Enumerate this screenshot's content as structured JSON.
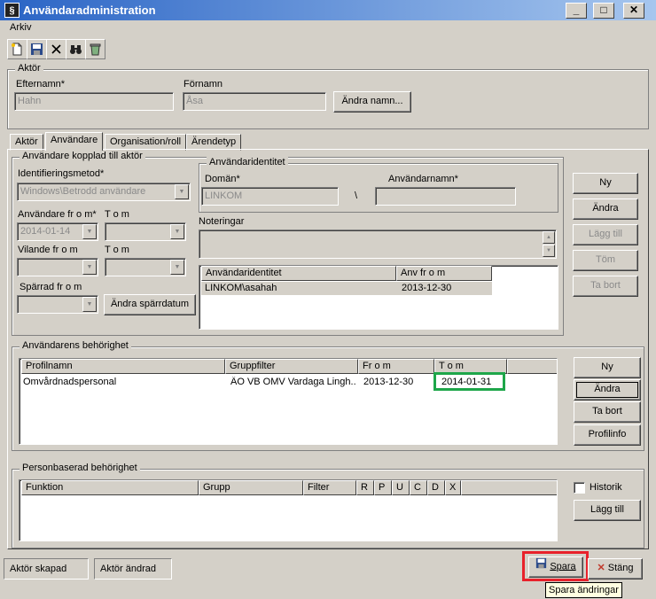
{
  "window": {
    "title": "Användaradministration",
    "minimize": "_",
    "maximize": "□",
    "close": "✕"
  },
  "menu": {
    "arkiv": "Arkiv"
  },
  "toolbar": {
    "icons": [
      "new-document-icon",
      "save-icon",
      "delete-icon",
      "binoculars-icon",
      "recycle-bin-icon"
    ]
  },
  "aktor": {
    "legend": "Aktör",
    "efternamn_label": "Efternamn*",
    "efternamn_value": "Hahn",
    "fornamn_label": "Förnamn",
    "fornamn_value": "Åsa",
    "andra_namn_button": "Ändra namn..."
  },
  "tabs": [
    "Aktör",
    "Användare",
    "Organisation/roll",
    "Ärendetyp"
  ],
  "active_tab": "Användare",
  "anvandare_kopplad": {
    "legend": "Användare kopplad till aktör",
    "identifieringsmetod_label": "Identifieringsmetod*",
    "identifieringsmetod_value": "Windows\\Betrodd användare",
    "anvandare_from_label": "Användare fr o m*",
    "anvandare_from_value": "2014-01-14",
    "anvandare_tom_label": "T o m",
    "vilande_from_label": "Vilande fr o m",
    "vilande_tom_label": "T o m",
    "sparrad_from_label": "Spärrad fr o m",
    "andra_sparrdatum_button": "Ändra spärrdatum"
  },
  "anvandaridentitet": {
    "legend": "Användaridentitet",
    "doman_label": "Domän*",
    "doman_value": "LINKOM",
    "separator": "\\",
    "anvandarnamn_label": "Användarnamn*",
    "anvandarnamn_value": ""
  },
  "noteringar": {
    "label": "Noteringar"
  },
  "identitet_table": {
    "headers": [
      "Användaridentitet",
      "Anv fr o m"
    ],
    "rows": [
      [
        "LINKOM\\asahah",
        "2013-12-30"
      ]
    ]
  },
  "right_buttons_top": [
    "Ny",
    "Ändra",
    "Lägg till",
    "Töm",
    "Ta bort"
  ],
  "behorighet": {
    "legend": "Användarens behörighet",
    "headers": [
      "Profilnamn",
      "Gruppfilter",
      "Fr o m",
      "T o m"
    ],
    "rows": [
      [
        "Omvårdnadspersonal",
        "ÄO VB OMV Vardaga Lingh...",
        "2013-12-30",
        "2014-01-31"
      ]
    ],
    "buttons": [
      "Ny",
      "Ändra",
      "Ta bort",
      "Profilinfo"
    ]
  },
  "personbaserad": {
    "legend": "Personbaserad behörighet",
    "headers": [
      "Funktion",
      "Grupp",
      "Filter",
      "R",
      "P",
      "U",
      "C",
      "D",
      "X"
    ],
    "historik_label": "Historik",
    "lagg_till_button": "Lägg till"
  },
  "statusbar": {
    "aktor_skapad": "Aktör skapad",
    "aktor_andrad": "Aktör ändrad"
  },
  "footer": {
    "spara": "Spara",
    "stang": "Stäng",
    "tooltip": "Spara ändringar"
  },
  "colors": {
    "highlight_green": "#1ea64a",
    "highlight_red": "#e8212b",
    "titlebar": "#2a64c5"
  }
}
